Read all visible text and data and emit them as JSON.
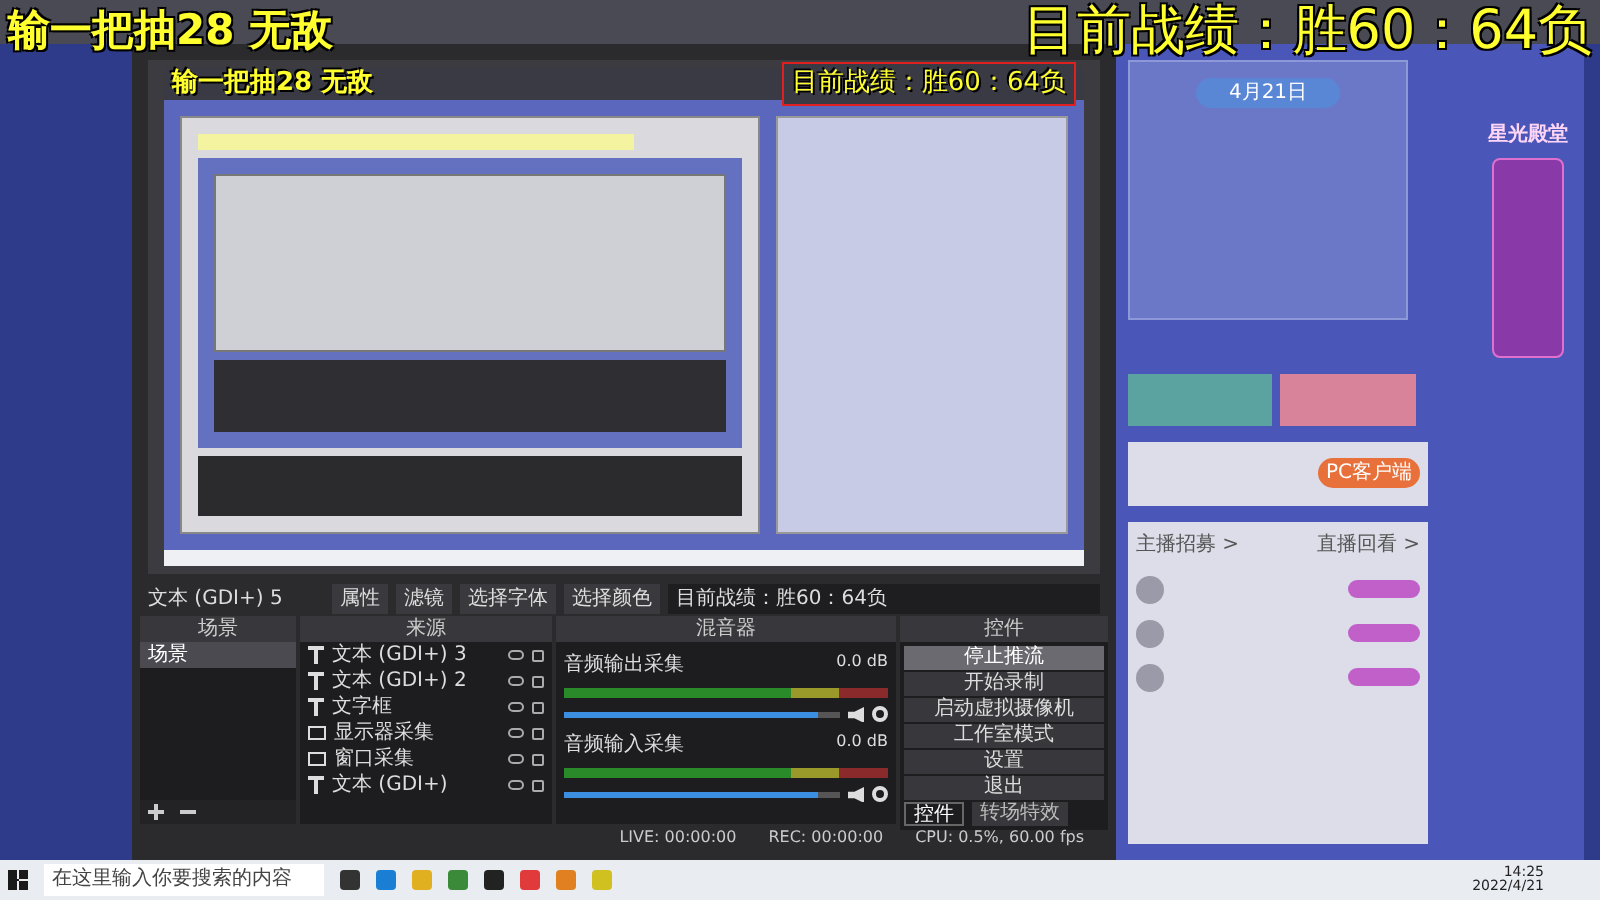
{
  "overlay": {
    "left_text": "输一把抽28 无敌",
    "right_text": "目前战绩：胜60：64负"
  },
  "obs": {
    "preview": {
      "left_text": "输一把抽28 无敌",
      "right_text": "目前战绩：胜60：64负"
    },
    "selected_source": "文本 (GDI+) 5",
    "toolbar_buttons": [
      "属性",
      "滤镜",
      "选择字体",
      "选择颜色"
    ],
    "text_field": "目前战绩：胜60：64负",
    "scenes": {
      "title": "场景",
      "items": [
        {
          "label": "场景",
          "selected": true
        }
      ]
    },
    "sources": {
      "title": "来源",
      "items": [
        {
          "label": "文本 (GDI+) 3",
          "kind": "text"
        },
        {
          "label": "文本 (GDI+) 2",
          "kind": "text"
        },
        {
          "label": "文字框",
          "kind": "text"
        },
        {
          "label": "显示器采集",
          "kind": "monitor"
        },
        {
          "label": "窗口采集",
          "kind": "monitor"
        },
        {
          "label": "文本 (GDI+)",
          "kind": "text"
        }
      ]
    },
    "mixer": {
      "title": "混音器",
      "channels": [
        {
          "name": "音频输出采集",
          "reading": "0.0 dB",
          "level": 0.92
        },
        {
          "name": "音频输入采集",
          "reading": "0.0 dB",
          "level": 0.92
        }
      ]
    },
    "controls": {
      "title": "控件",
      "buttons": [
        {
          "label": "停止推流",
          "selected": true
        },
        {
          "label": "开始录制",
          "selected": false
        },
        {
          "label": "启动虚拟摄像机",
          "selected": false
        },
        {
          "label": "工作室模式",
          "selected": false
        },
        {
          "label": "设置",
          "selected": false
        },
        {
          "label": "退出",
          "selected": false
        }
      ],
      "tabs": [
        {
          "label": "控件",
          "selected": true
        },
        {
          "label": "转场特效",
          "selected": false
        }
      ]
    },
    "status_bar": [
      "LIVE: 00:00:00",
      "REC: 00:00:00",
      "CPU: 0.5%, 60.00 fps"
    ]
  },
  "webpage": {
    "date": "4月21日",
    "client_badge": "PC客户端",
    "links": [
      "主播招募 >",
      "直播回看 >"
    ],
    "banner": "星光殿堂"
  },
  "taskbar": {
    "search_placeholder": "在这里输入你要搜索的内容",
    "time": "14:25",
    "date": "2022/4/21"
  }
}
